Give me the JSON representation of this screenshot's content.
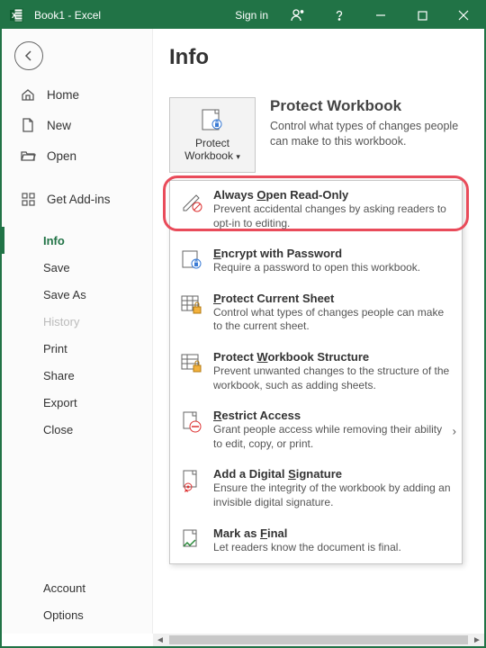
{
  "titlebar": {
    "title": "Book1 - Excel",
    "signin": "Sign in"
  },
  "sidebar": {
    "home": "Home",
    "new": "New",
    "open": "Open",
    "addins": "Get Add-ins",
    "info": "Info",
    "save": "Save",
    "saveas": "Save As",
    "history": "History",
    "print": "Print",
    "share": "Share",
    "export": "Export",
    "close": "Close",
    "account": "Account",
    "options": "Options"
  },
  "page": {
    "title": "Info"
  },
  "protect": {
    "button_line1": "Protect",
    "button_line2": "Workbook",
    "heading": "Protect Workbook",
    "desc": "Control what types of changes people can make to this workbook."
  },
  "menu": {
    "readonly": {
      "title": "Always Open Read-Only",
      "u": "O",
      "desc": "Prevent accidental changes by asking readers to opt-in to editing."
    },
    "encrypt": {
      "title": "Encrypt with Password",
      "u": "E",
      "desc": "Require a password to open this workbook."
    },
    "sheet": {
      "title": "Protect Current Sheet",
      "u": "P",
      "desc": "Control what types of changes people can make to the current sheet."
    },
    "struct": {
      "title": "Protect Workbook Structure",
      "u": "W",
      "desc": "Prevent unwanted changes to the structure of the workbook, such as adding sheets."
    },
    "restrict": {
      "title": "Restrict Access",
      "u": "R",
      "desc": "Grant people access while removing their ability to edit, copy, or print."
    },
    "sign": {
      "title": "Add a Digital Signature",
      "u": "S",
      "desc": "Ensure the integrity of the workbook by adding an invisible digital signature."
    },
    "final": {
      "title": "Mark as Final",
      "u": "F",
      "desc": "Let readers know the document is final."
    }
  }
}
